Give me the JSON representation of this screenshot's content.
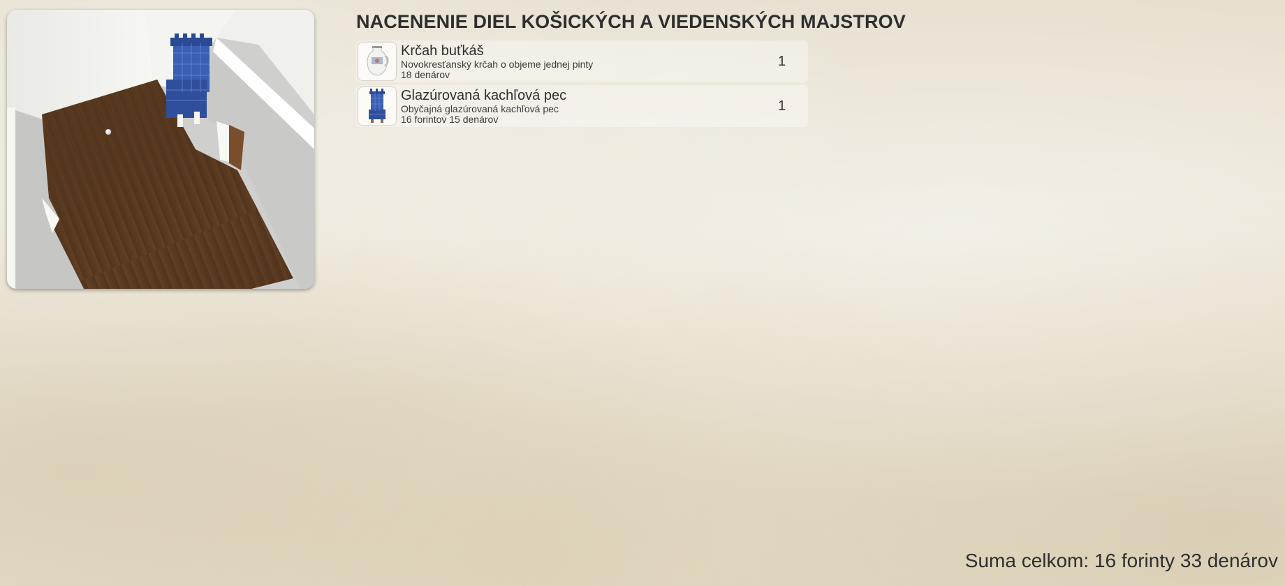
{
  "page": {
    "title": "NACENENIE DIEL KOŠICKÝCH A VIEDENSKÝCH MAJSTROV"
  },
  "preview": {
    "icon": "room-3d-preview"
  },
  "items": [
    {
      "name": "Krčah buťkáš",
      "description": "Novokresťanský krčah o objeme jednej pinty",
      "price": "18 denárov",
      "quantity": "1",
      "icon": "jug-icon"
    },
    {
      "name": "Glazúrovaná kachľová pec",
      "description": "Obyčajná glazúrovaná kachľová pec",
      "price": "16 forintov 15 denárov",
      "quantity": "1",
      "icon": "tile-stove-icon"
    }
  ],
  "summary": {
    "total": "Suma celkom: 16 forinty 33 denárov"
  },
  "colors": {
    "stove_blue": "#3a5fb5",
    "floor_wood": "#5a3a22",
    "background": "#e8e1d1"
  }
}
